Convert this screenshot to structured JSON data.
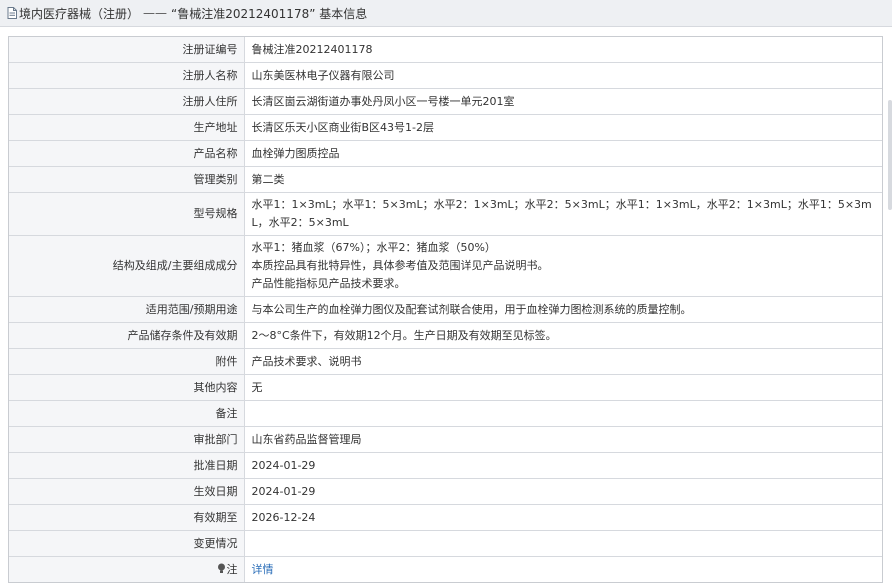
{
  "header": {
    "icon": "document-icon",
    "part1": "境内医疗器械（注册）",
    "separator": "——",
    "part2": "“鲁械注准20212401178” 基本信息"
  },
  "rows": [
    {
      "label": "注册证编号",
      "value": "鲁械注准20212401178"
    },
    {
      "label": "注册人名称",
      "value": "山东美医林电子仪器有限公司"
    },
    {
      "label": "注册人住所",
      "value": "长清区崮云湖街道办事处丹凤小区一号楼一单元201室"
    },
    {
      "label": "生产地址",
      "value": "长清区乐天小区商业街B区43号1-2层"
    },
    {
      "label": "产品名称",
      "value": "血栓弹力图质控品"
    },
    {
      "label": "管理类别",
      "value": "第二类"
    },
    {
      "label": "型号规格",
      "value": "水平1：1×3mL；水平1：5×3mL；水平2：1×3mL；水平2：5×3mL；水平1：1×3mL，水平2：1×3mL；水平1：5×3mL，水平2：5×3mL"
    },
    {
      "label": "结构及组成/主要组成成分",
      "lines": [
        "水平1：猪血浆（67%）；水平2：猪血浆（50%）",
        "本质控品具有批特异性，具体参考值及范围详见产品说明书。",
        "产品性能指标见产品技术要求。"
      ]
    },
    {
      "label": "适用范围/预期用途",
      "value": "与本公司生产的血栓弹力图仪及配套试剂联合使用，用于血栓弹力图检测系统的质量控制。"
    },
    {
      "label": "产品储存条件及有效期",
      "value": "2～8°C条件下，有效期12个月。生产日期及有效期至见标签。"
    },
    {
      "label": "附件",
      "value": "产品技术要求、说明书"
    },
    {
      "label": "其他内容",
      "value": "无"
    },
    {
      "label": "备注",
      "value": ""
    },
    {
      "label": "审批部门",
      "value": "山东省药品监督管理局"
    },
    {
      "label": "批准日期",
      "value": "2024-01-29"
    },
    {
      "label": "生效日期",
      "value": "2024-01-29"
    },
    {
      "label": "有效期至",
      "value": "2026-12-24"
    },
    {
      "label": "变更情况",
      "value": ""
    },
    {
      "label": "注",
      "icon": "lightbulb-icon",
      "value": "详情"
    }
  ],
  "colors": {
    "label_bg": "#f5f6f8",
    "border": "#d6d9de",
    "link": "#2a6db8",
    "header_bg": "#eef0f3"
  }
}
